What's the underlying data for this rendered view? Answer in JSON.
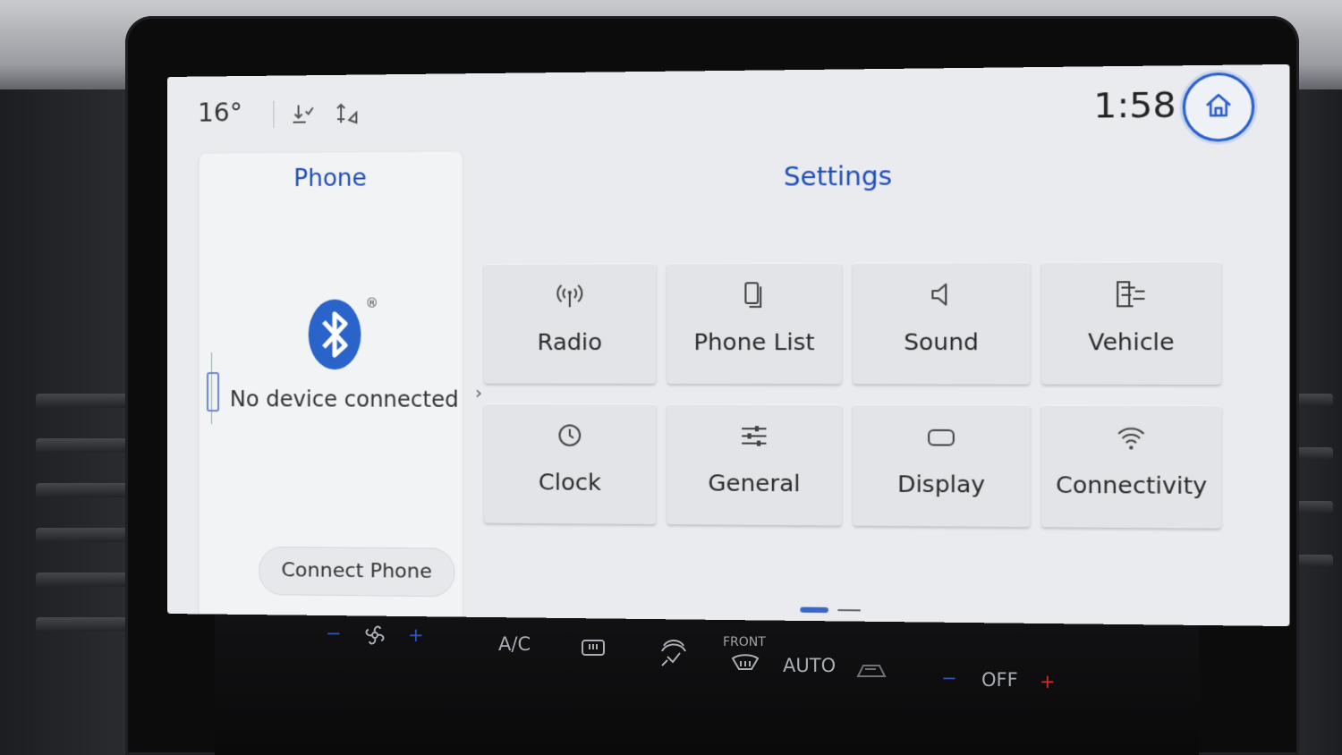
{
  "status_bar": {
    "temperature": "16°",
    "time": "1:58",
    "icons": [
      "download-icon",
      "sort-icon",
      "home-icon"
    ]
  },
  "phone_panel": {
    "title": "Phone",
    "registered_mark": "®",
    "status": "No device connected",
    "connect_button": "Connect Phone",
    "icon": "bluetooth-icon"
  },
  "settings": {
    "title": "Settings",
    "tiles": [
      {
        "label": "Radio",
        "icon": "antenna-icon"
      },
      {
        "label": "Phone List",
        "icon": "phones-icon"
      },
      {
        "label": "Sound",
        "icon": "speaker-icon"
      },
      {
        "label": "Vehicle",
        "icon": "vehicle-icon"
      },
      {
        "label": "Clock",
        "icon": "clock-icon"
      },
      {
        "label": "General",
        "icon": "sliders-icon"
      },
      {
        "label": "Display",
        "icon": "display-icon"
      },
      {
        "label": "Connectivity",
        "icon": "wifi-icon"
      }
    ],
    "page_indicator": {
      "pages": 2,
      "current": 1
    }
  },
  "climate_controls": {
    "fan_minus": "−",
    "fan_plus": "+",
    "ac_label": "A/C",
    "front_label": "FRONT",
    "auto_label": "AUTO",
    "temp_minus": "−",
    "temp_value": "OFF",
    "temp_plus": "+"
  },
  "colors": {
    "accent": "#1f4db8",
    "screen_bg": "#e9ebee",
    "tile_bg": "#e2e4e8",
    "bluetooth": "#2a63c9",
    "plus_red": "#c8312d"
  }
}
